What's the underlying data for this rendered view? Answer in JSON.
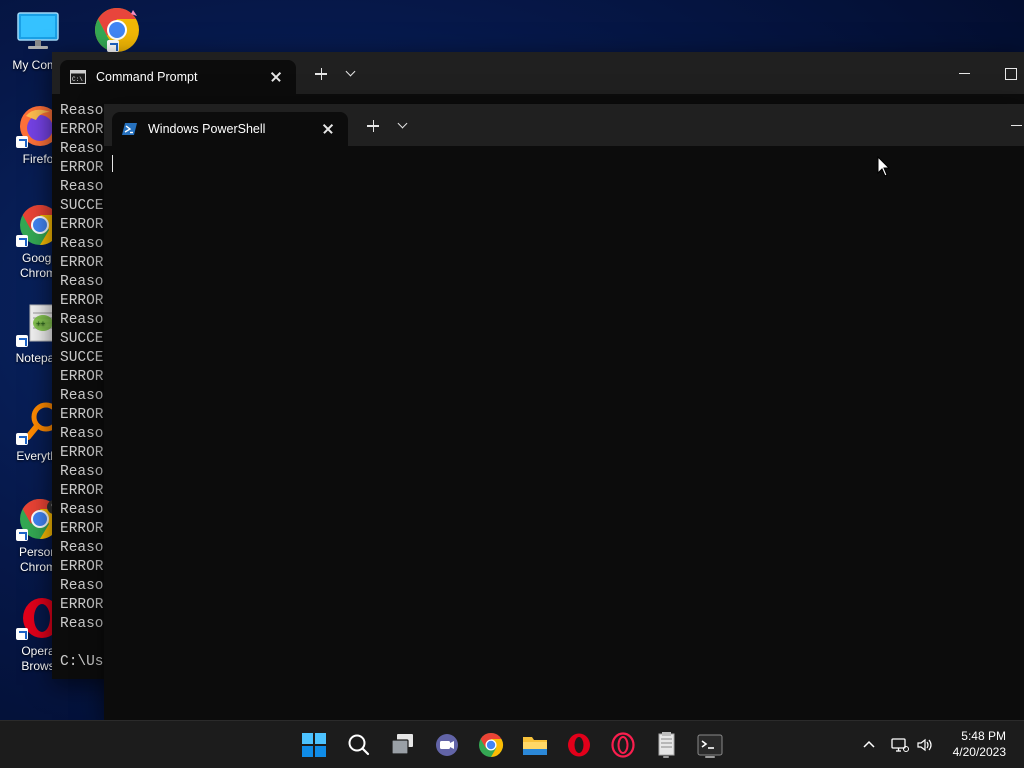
{
  "desktop": {
    "icons": [
      {
        "label": "My Comp",
        "icon": "monitor-icon"
      },
      {
        "label": "",
        "icon": "chrome-canary-icon"
      },
      {
        "label": "Firefo",
        "icon": "firefox-icon"
      },
      {
        "label": "Googl\nChrom",
        "icon": "chrome-icon"
      },
      {
        "label": "Notepac",
        "icon": "notepad-plus-plus-icon"
      },
      {
        "label": "Everythi",
        "icon": "everything-search-icon"
      },
      {
        "label": "Person\nChrom",
        "icon": "chrome-profile-icon"
      },
      {
        "label": "Opera\nBrows",
        "icon": "opera-icon"
      }
    ]
  },
  "cmd_window": {
    "tab_title": "Command Prompt",
    "lines": [
      "Reaso",
      "ERROR",
      "Reaso",
      "ERROR",
      "Reaso",
      "SUCCE",
      "ERROR",
      "Reaso",
      "ERROR",
      "Reaso",
      "ERROR",
      "Reaso",
      "SUCCE",
      "SUCCE",
      "ERROR",
      "Reaso",
      "ERROR",
      "Reaso",
      "ERROR",
      "Reaso",
      "ERROR",
      "Reaso",
      "ERROR",
      "Reaso",
      "ERROR",
      "Reaso",
      "ERROR",
      "Reaso",
      "",
      "C:\\Us"
    ]
  },
  "ps_window": {
    "tab_title": "Windows PowerShell"
  },
  "taskbar": {
    "apps": [
      {
        "icon": "start-icon"
      },
      {
        "icon": "search-icon"
      },
      {
        "icon": "task-view-icon"
      },
      {
        "icon": "teams-chat-icon"
      },
      {
        "icon": "chrome-icon"
      },
      {
        "icon": "file-explorer-icon"
      },
      {
        "icon": "opera-icon"
      },
      {
        "icon": "opera-gx-icon"
      },
      {
        "icon": "notepad-plus-plus-icon"
      },
      {
        "icon": "terminal-icon"
      }
    ],
    "tray_icons": [
      "chevron-up-icon",
      "network-icon",
      "volume-icon"
    ],
    "time": "5:48 PM",
    "date": "4/20/2023"
  },
  "colors": {
    "desktop_bg": "#06184a",
    "terminal_bg": "#0c0c0c",
    "titlebar_bg": "#202020",
    "taskbar_bg": "#1c1c1c"
  }
}
